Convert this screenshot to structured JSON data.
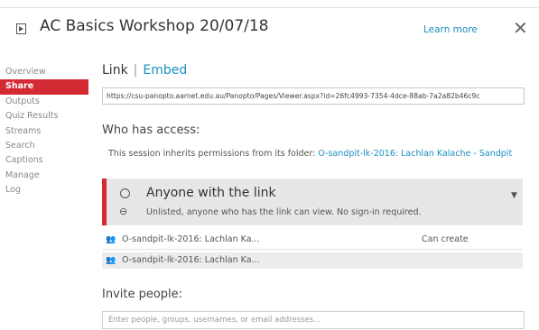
{
  "header": {
    "title": "AC Basics Workshop 20/07/18",
    "learn_more": "Learn more",
    "close_glyph": "✕"
  },
  "sidebar": {
    "items": [
      {
        "label": "Overview",
        "active": false
      },
      {
        "label": "Share",
        "active": true
      },
      {
        "label": "Outputs",
        "active": false
      },
      {
        "label": "Quiz Results",
        "active": false
      },
      {
        "label": "Streams",
        "active": false
      },
      {
        "label": "Search",
        "active": false
      },
      {
        "label": "Captions",
        "active": false
      },
      {
        "label": "Manage",
        "active": false
      },
      {
        "label": "Log",
        "active": false
      }
    ]
  },
  "share": {
    "tab_link": "Link",
    "tab_embed": "Embed",
    "url": "https://csu-panopto.aarnet.edu.au/Panopto/Pages/Viewer.aspx?id=26fc4993-7354-4dce-88ab-7a2a82b46c9c",
    "access_heading": "Who has access:",
    "inherit_text": "This session inherits permissions from its folder: ",
    "inherit_folder": "O-sandpit-lk-2016: Lachlan Kalache - Sandpit",
    "access_level": {
      "title": "Anyone with the link",
      "description": "Unlisted, anyone who has the link can view. No sign-in required."
    },
    "permissions": [
      {
        "name": "O-sandpit-lk-2016: Lachlan Ka...",
        "role": "Can create"
      },
      {
        "name": "O-sandpit-lk-2016: Lachlan Ka...",
        "role": ""
      }
    ],
    "invite_heading": "Invite people:",
    "invite_placeholder": "Enter people, groups, usernames, or email addresses..."
  },
  "icons": {
    "play": "play-icon",
    "close": "close-icon",
    "globe": "globe-icon",
    "link": "link-icon",
    "dropdown": "chevron-down-icon",
    "people": "people-icon"
  },
  "colors": {
    "accent_red": "#d32a34",
    "link_blue": "#1a8fc1",
    "panel_gray": "#e7e7e7"
  }
}
